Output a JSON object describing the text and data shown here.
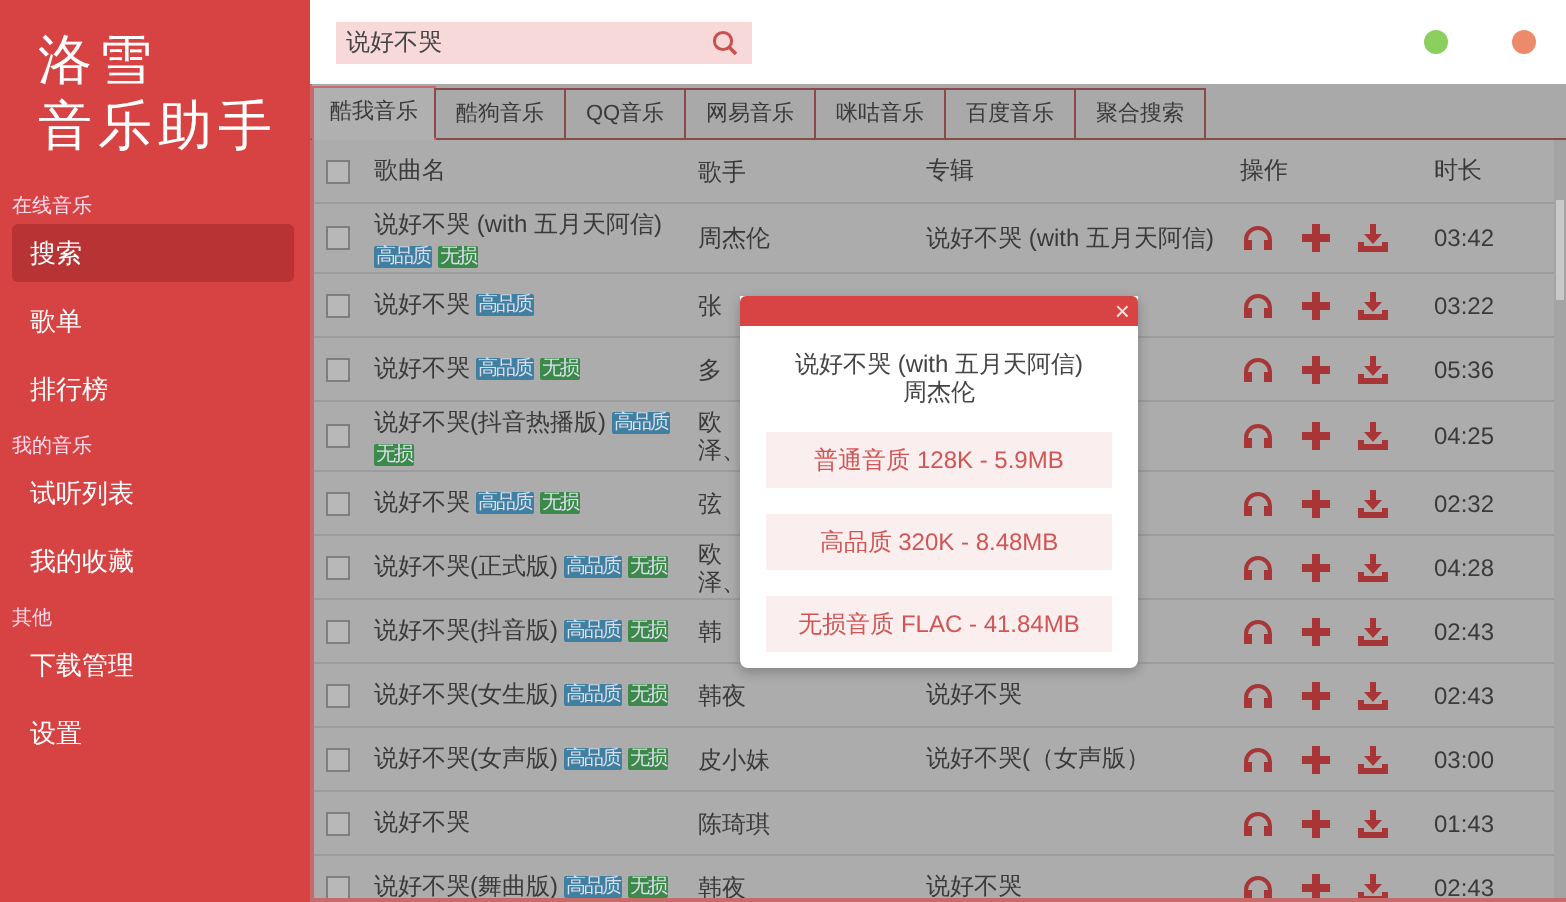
{
  "sidebar": {
    "logo": [
      "洛雪",
      "音乐助手"
    ],
    "sections": [
      {
        "title": "在线音乐",
        "items": [
          {
            "label": "搜索",
            "selected": true
          },
          {
            "label": "歌单",
            "selected": false
          },
          {
            "label": "排行榜",
            "selected": false
          }
        ]
      },
      {
        "title": "我的音乐",
        "items": [
          {
            "label": "试听列表",
            "selected": false
          },
          {
            "label": "我的收藏",
            "selected": false
          }
        ]
      },
      {
        "title": "其他",
        "items": [
          {
            "label": "下载管理",
            "selected": false
          },
          {
            "label": "设置",
            "selected": false
          }
        ]
      }
    ]
  },
  "search": {
    "value": "说好不哭"
  },
  "window_controls": [
    {
      "color": "#8bcf5f"
    },
    {
      "color": "#ee8a6c"
    }
  ],
  "tabs": [
    {
      "label": "酷我音乐",
      "selected": true
    },
    {
      "label": "酷狗音乐",
      "selected": false
    },
    {
      "label": "QQ音乐",
      "selected": false
    },
    {
      "label": "网易音乐",
      "selected": false
    },
    {
      "label": "咪咕音乐",
      "selected": false
    },
    {
      "label": "百度音乐",
      "selected": false
    },
    {
      "label": "聚合搜索",
      "selected": false
    }
  ],
  "table": {
    "checked": false,
    "columns": [
      "歌曲名",
      "歌手",
      "专辑",
      "操作",
      "时长"
    ]
  },
  "songs": [
    {
      "checked": false,
      "title": "说好不哭 (with 五月天阿信)",
      "tags": [
        {
          "label": "高品质",
          "color": "#3f7fa0"
        },
        {
          "label": "无损",
          "color": "#3b8a4a"
        }
      ],
      "singer": "周杰伦",
      "album": "说好不哭 (with 五月天阿信)",
      "duration": "03:42"
    },
    {
      "checked": false,
      "title": "说好不哭",
      "tags": [
        {
          "label": "高品质",
          "color": "#3f7fa0"
        }
      ],
      "singer": "张",
      "duration": "03:22"
    },
    {
      "checked": false,
      "title": "说好不哭",
      "tags": [
        {
          "label": "高品质",
          "color": "#3f7fa0"
        },
        {
          "label": "无损",
          "color": "#3b8a4a"
        }
      ],
      "singer": "多",
      "duration": "05:36"
    },
    {
      "checked": false,
      "title": "说好不哭(抖音热播版)",
      "tags": [
        {
          "label": "高品质",
          "color": "#3f7fa0"
        },
        {
          "label": "无损",
          "color": "#3b8a4a"
        }
      ],
      "singer": [
        "欧",
        "泽、"
      ],
      "duration": "04:25"
    },
    {
      "checked": false,
      "title": "说好不哭",
      "tags": [
        {
          "label": "高品质",
          "color": "#3f7fa0"
        },
        {
          "label": "无损",
          "color": "#3b8a4a"
        }
      ],
      "singer": "弦",
      "duration": "02:32"
    },
    {
      "checked": false,
      "title": "说好不哭(正式版)",
      "tags": [
        {
          "label": "高品质",
          "color": "#3f7fa0"
        },
        {
          "label": "无损",
          "color": "#3b8a4a"
        }
      ],
      "singer": [
        "欧",
        "泽、"
      ],
      "duration": "04:28"
    },
    {
      "checked": false,
      "title": "说好不哭(抖音版)",
      "tags": [
        {
          "label": "高品质",
          "color": "#3f7fa0"
        },
        {
          "label": "无损",
          "color": "#3b8a4a"
        }
      ],
      "singer": "韩",
      "duration": "02:43"
    },
    {
      "checked": false,
      "title": "说好不哭(女生版)",
      "tags": [
        {
          "label": "高品质",
          "color": "#3f7fa0"
        },
        {
          "label": "无损",
          "color": "#3b8a4a"
        }
      ],
      "singer": "韩夜",
      "album": "说好不哭",
      "duration": "02:43"
    },
    {
      "checked": false,
      "title": "说好不哭(女声版)",
      "tags": [
        {
          "label": "高品质",
          "color": "#3f7fa0"
        },
        {
          "label": "无损",
          "color": "#3b8a4a"
        }
      ],
      "singer": "皮小妹",
      "album": "说好不哭(（女声版）",
      "duration": "03:00"
    },
    {
      "checked": false,
      "title": "说好不哭",
      "singer": "陈琦琪",
      "duration": "01:43"
    },
    {
      "checked": false,
      "title": "说好不哭(舞曲版)",
      "tags": [
        {
          "label": "高品质",
          "color": "#3f7fa0"
        },
        {
          "label": "无损",
          "color": "#3b8a4a"
        }
      ],
      "singer": "韩夜",
      "album": "说好不哭",
      "duration": "02:43"
    }
  ],
  "dialog": {
    "close": "×",
    "title": "说好不哭 (with 五月天阿信)",
    "artist": "周杰伦",
    "options": [
      "普通音质 128K - 5.9MB",
      "高品质 320K - 8.48MB",
      "无损音质 FLAC - 41.84MB"
    ]
  }
}
